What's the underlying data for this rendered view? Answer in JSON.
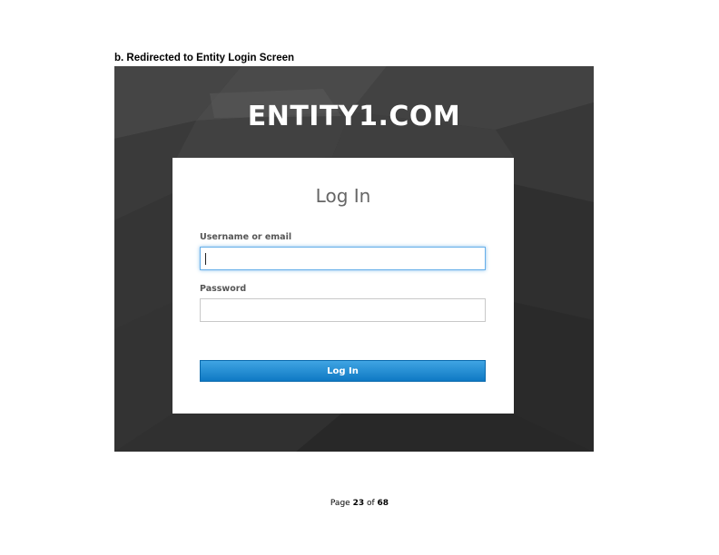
{
  "document": {
    "heading": "b.  Redirected to Entity Login Screen",
    "footer": {
      "prefix": "Page",
      "current_page": "23",
      "separator": "of",
      "total_pages": "68"
    }
  },
  "login_page": {
    "brand": "ENTITY1.COM",
    "title": "Log In",
    "username_label": "Username or email",
    "username_value": "",
    "password_label": "Password",
    "password_value": "",
    "submit_label": "Log In"
  },
  "colors": {
    "background": "#3b3b3b",
    "button": "#1a86d0",
    "focus_border": "#66afe9"
  }
}
